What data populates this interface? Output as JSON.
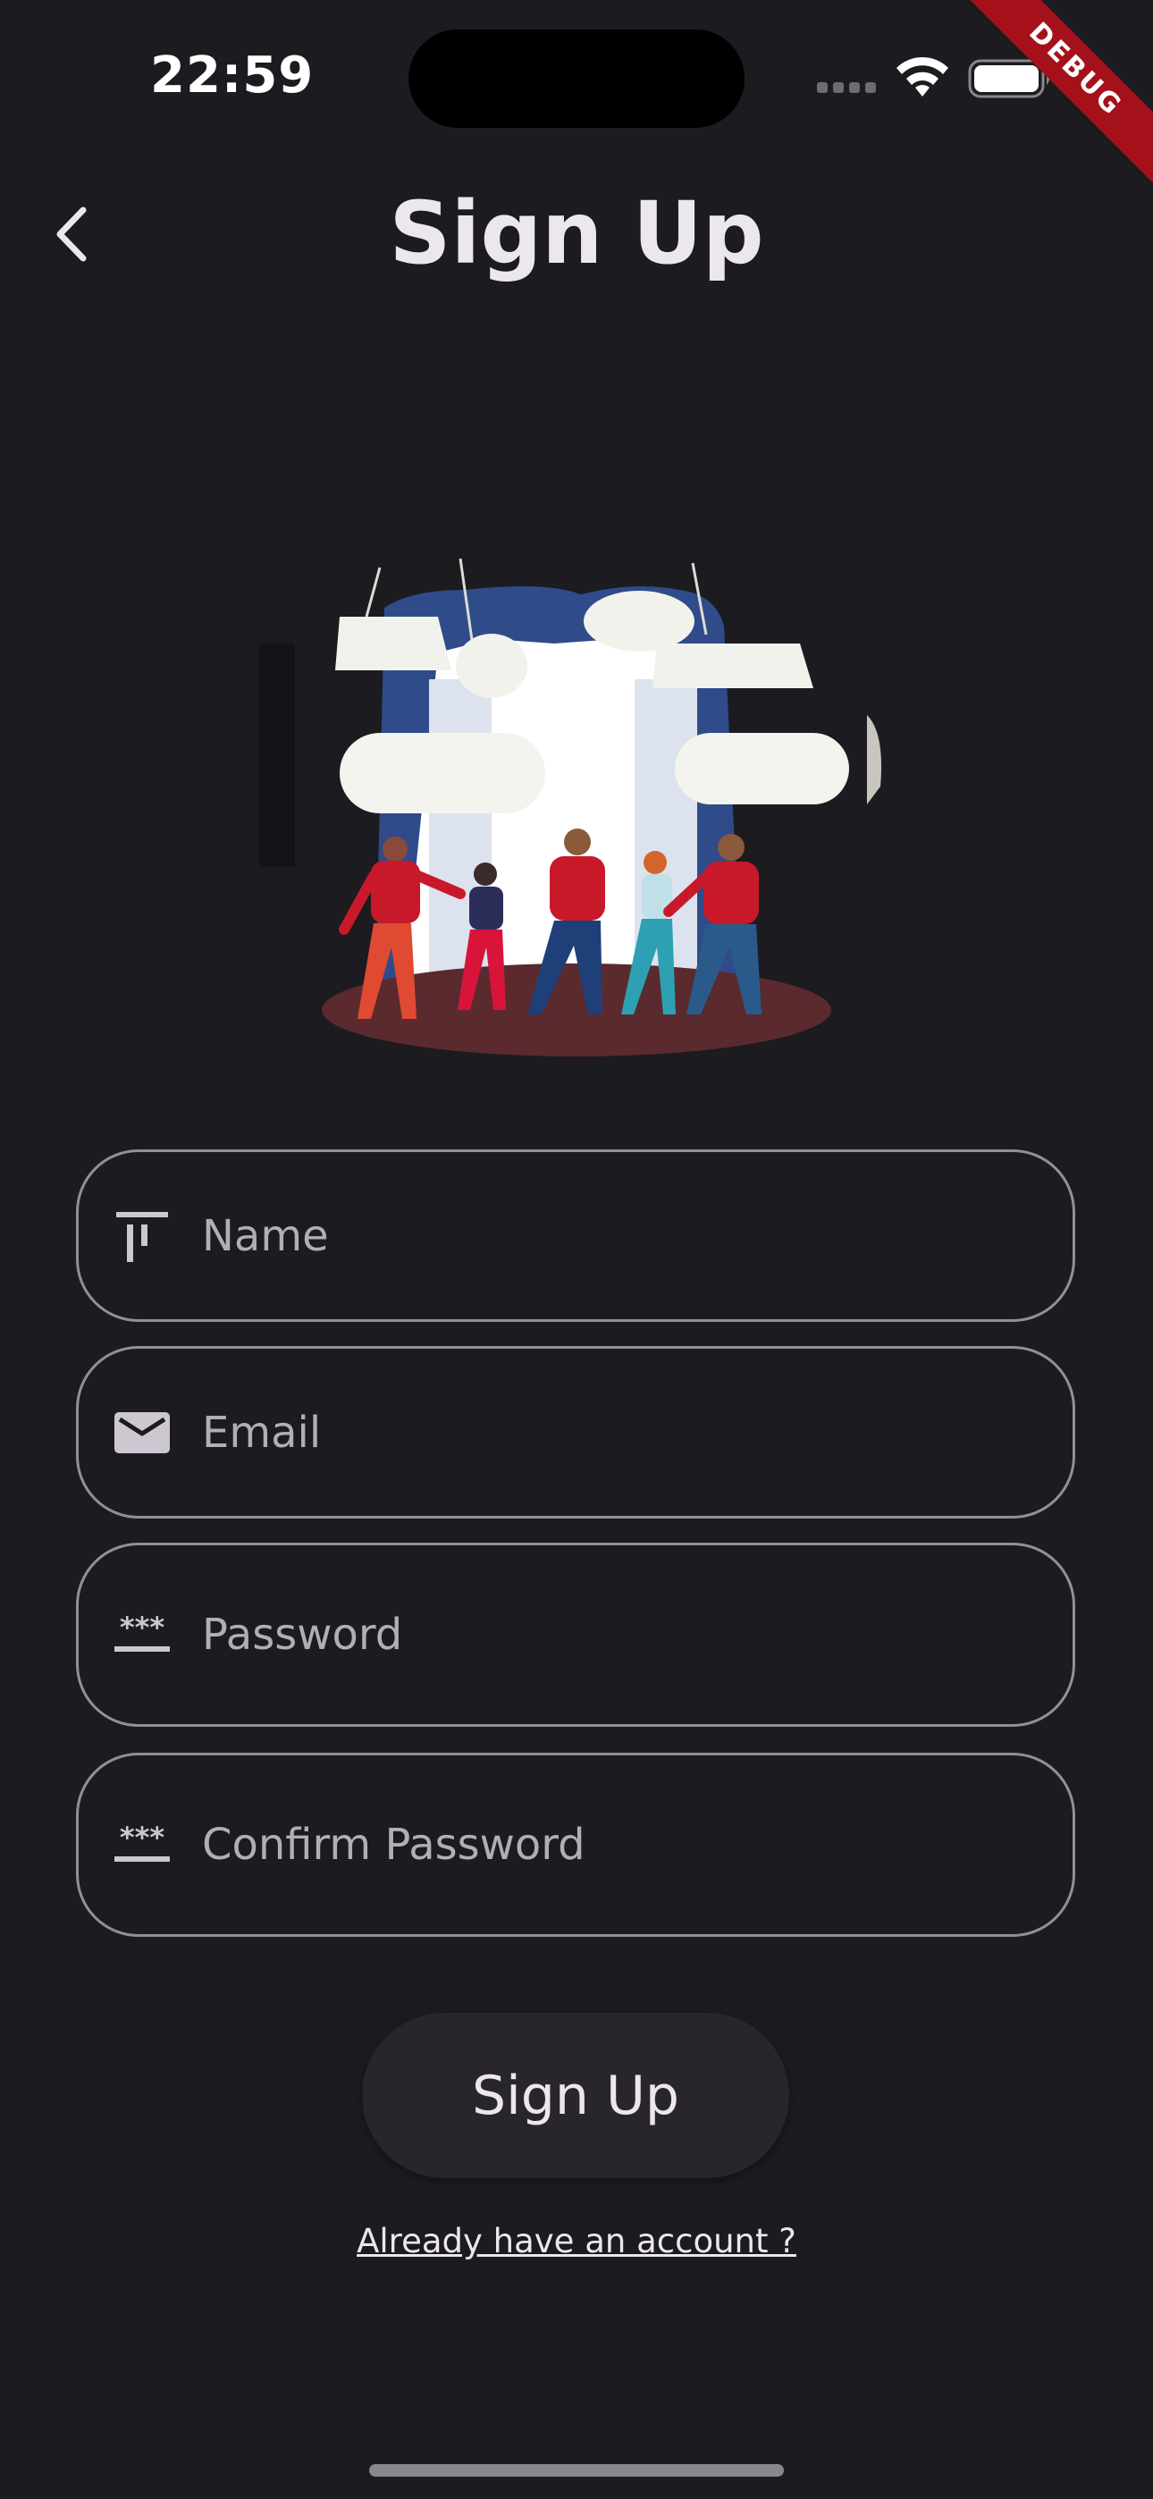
{
  "status_bar": {
    "time": "22:59"
  },
  "debug_banner": "DEBUG",
  "app_bar": {
    "title": "Sign Up",
    "back_icon": "chevron-left-icon"
  },
  "form": {
    "name": {
      "placeholder": "Name",
      "icon": "text-fields-icon"
    },
    "email": {
      "placeholder": "Email",
      "icon": "email-icon"
    },
    "password": {
      "placeholder": "Password",
      "icon": "password-icon"
    },
    "confirm_password": {
      "placeholder": "Confirm Password",
      "icon": "password-icon"
    }
  },
  "signup_button": "Sign Up",
  "login_link": "Already have an account ?",
  "colors": {
    "background": "#1c1b1f",
    "outline": "#938f99",
    "button": "#28262c",
    "debug": "#a5111a"
  }
}
